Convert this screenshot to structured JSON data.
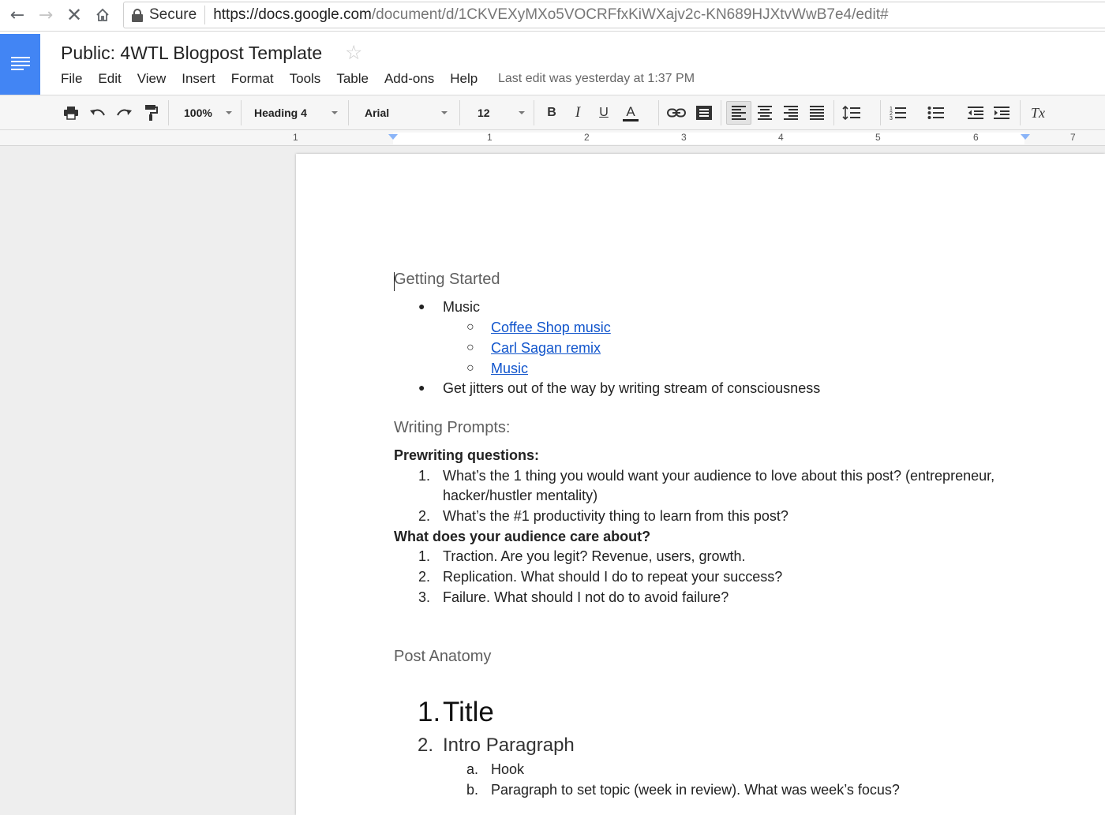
{
  "browser": {
    "secure_label": "Secure",
    "url_host": "https://docs.google.com",
    "url_path": "/document/d/1CKVEXyMXo5VOCRFfxKiWXajv2c-KN689HJXtvWwB7e4/edit#"
  },
  "header": {
    "title": "Public: 4WTL Blogpost Template",
    "menu": [
      "File",
      "Edit",
      "View",
      "Insert",
      "Format",
      "Tools",
      "Table",
      "Add-ons",
      "Help"
    ],
    "last_edit": "Last edit was yesterday at 1:37 PM"
  },
  "toolbar": {
    "zoom": "100%",
    "style": "Heading 4",
    "font": "Arial",
    "size": "12",
    "bold": "B",
    "italic": "I",
    "underline": "U",
    "text_color": "A",
    "clear_formatting": "Tx"
  },
  "ruler": {
    "labels": [
      "1",
      "1",
      "2",
      "3",
      "4",
      "5",
      "6",
      "7"
    ]
  },
  "document": {
    "getting_started": {
      "heading": "Getting Started",
      "items": [
        {
          "bullet": "●",
          "text": "Music"
        },
        {
          "bullet": "○",
          "text": "Coffee Shop music"
        },
        {
          "bullet": "○",
          "text": "Carl Sagan remix"
        },
        {
          "bullet": "○",
          "text": "Music"
        },
        {
          "bullet": "●",
          "text": "Get jitters out of the way by writing stream of consciousness"
        }
      ]
    },
    "writing_prompts": {
      "heading": "Writing Prompts:",
      "prewriting_label": "Prewriting questions:",
      "prewriting_items": [
        {
          "num": "1.",
          "line1": "What’s the 1 thing you would want your audience to love about this post? (entrepreneur,",
          "line2": "hacker/hustler mentality)"
        },
        {
          "num": "2.",
          "line1": "What’s the #1 productivity thing to learn from this post?"
        }
      ],
      "audience_label": "What does your audience care about?",
      "audience_items": [
        {
          "num": "1.",
          "text": "Traction. Are you legit? Revenue, users, growth."
        },
        {
          "num": "2.",
          "text": "Replication. What should I do to repeat your success?"
        },
        {
          "num": "3.",
          "text": "Failure. What should I not do to avoid failure?"
        }
      ]
    },
    "post_anatomy": {
      "heading": "Post Anatomy",
      "item1_num": "1.",
      "item1_text": "Title",
      "item2_num": "2.",
      "item2_text": "Intro Paragraph",
      "sub_items": [
        {
          "num": "a.",
          "text": "Hook"
        },
        {
          "num": "b.",
          "text": "Paragraph to set topic (week in review). What was week’s focus?"
        }
      ]
    }
  },
  "colors": {
    "docs_blue": "#4285f4",
    "link": "#1155cc"
  }
}
